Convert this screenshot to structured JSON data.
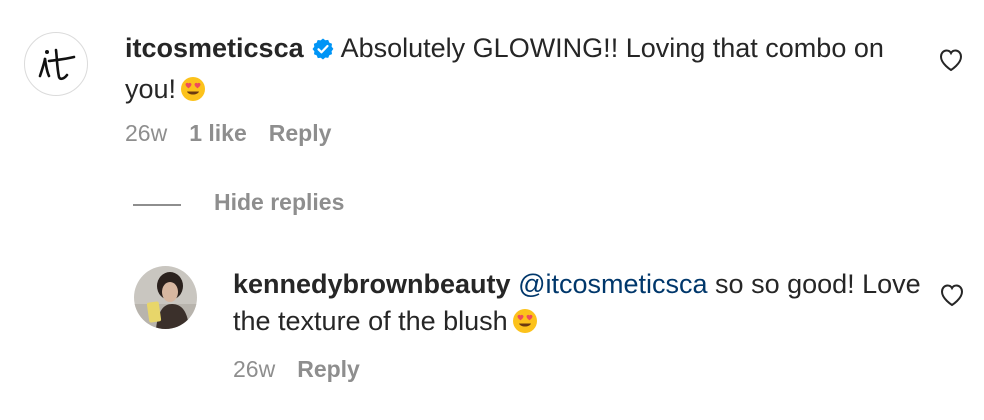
{
  "comment": {
    "username": "itcosmeticsca",
    "logo_text": "it",
    "text": "Absolutely GLOWING!! Loving that combo on you!",
    "emoji": "heart-eyes-emoji",
    "time": "26w",
    "likes": "1 like",
    "reply_label": "Reply"
  },
  "replies_toggle": {
    "label": "Hide replies"
  },
  "reply": {
    "username": "kennedybrownbeauty",
    "mention": "@itcosmeticsca",
    "text": "so so good! Love the texture of the blush",
    "emoji": "heart-eyes-emoji",
    "time": "26w",
    "reply_label": "Reply"
  },
  "colors": {
    "text": "#262626",
    "secondary": "#8e8e8e",
    "mention": "#00376b",
    "verified": "#0095f6"
  }
}
